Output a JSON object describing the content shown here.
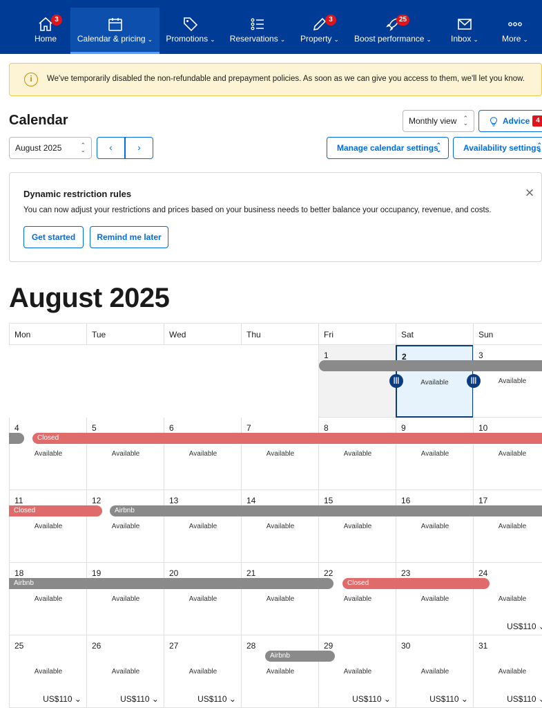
{
  "nav": {
    "items": [
      {
        "label": "Home",
        "badge": "3",
        "icon": "home-icon"
      },
      {
        "label": "Calendar & pricing",
        "icon": "calendar-icon"
      },
      {
        "label": "Promotions",
        "icon": "tag-icon"
      },
      {
        "label": "Reservations",
        "icon": "list-icon"
      },
      {
        "label": "Property",
        "badge": "3",
        "icon": "pencil-icon"
      },
      {
        "label": "Boost performance",
        "badge": "25",
        "icon": "rocket-icon"
      },
      {
        "label": "Inbox",
        "icon": "envelope-icon"
      },
      {
        "label": "More",
        "icon": "more-dots-icon"
      }
    ]
  },
  "alert": {
    "message": "We've temporarily disabled the non-refundable and prepayment policies. As soon as we can give you access to them, we'll let you know."
  },
  "header": {
    "title": "Calendar",
    "view_select": "Monthly view",
    "advice_label": "Advice",
    "advice_badge": "4",
    "month_select": "August 2025",
    "manage_label": "Manage calendar settings",
    "availability_label": "Availability settings"
  },
  "card": {
    "title": "Dynamic restriction rules",
    "body": "You can now adjust your restrictions and prices based on your business needs to better balance your occupancy, revenue, and costs.",
    "get_started": "Get started",
    "remind_later": "Remind me later"
  },
  "calendar": {
    "month_title": "August 2025",
    "weekdays": [
      "Mon",
      "Tue",
      "Wed",
      "Thu",
      "Fri",
      "Sat",
      "Sun"
    ],
    "available_label": "Available",
    "closed_label": "Closed",
    "airbnb_label": "Airbnb",
    "price": "US$110"
  },
  "colors": {
    "nav_bg": "#003b95",
    "accent": "#006ce4",
    "closed": "#e06b6b",
    "blocked": "#8a8a8a",
    "selected_border": "#0c3c80"
  }
}
